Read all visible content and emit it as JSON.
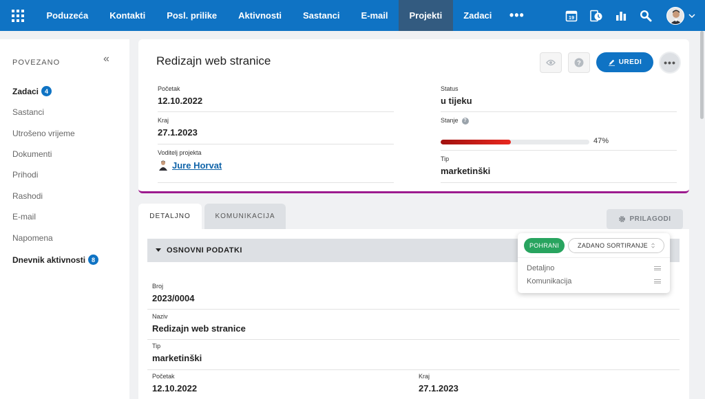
{
  "nav": {
    "items": [
      {
        "label": "Poduzeća",
        "active": false
      },
      {
        "label": "Kontakti",
        "active": false
      },
      {
        "label": "Posl. prilike",
        "active": false
      },
      {
        "label": "Aktivnosti",
        "active": false
      },
      {
        "label": "Sastanci",
        "active": false
      },
      {
        "label": "E-mail",
        "active": false
      },
      {
        "label": "Projekti",
        "active": true
      },
      {
        "label": "Zadaci",
        "active": false
      }
    ],
    "more": "•••",
    "calendar_day": "19",
    "brand_color": "#0f73c4"
  },
  "sidebar": {
    "heading": "POVEZANO",
    "collapse": "«",
    "items": [
      {
        "label": "Zadaci",
        "badge": "4",
        "bold": true
      },
      {
        "label": "Sastanci"
      },
      {
        "label": "Utrošeno vrijeme"
      },
      {
        "label": "Dokumenti"
      },
      {
        "label": "Prihodi"
      },
      {
        "label": "Rashodi"
      },
      {
        "label": "E-mail"
      },
      {
        "label": "Napomena"
      },
      {
        "label": "Dnevnik aktivnosti",
        "badge": "8",
        "bold": true
      }
    ]
  },
  "header": {
    "title": "Redizajn web stranice",
    "edit_label": "UREDI",
    "fields": {
      "start_label": "Početak",
      "start_value": "12.10.2022",
      "end_label": "Kraj",
      "end_value": "27.1.2023",
      "lead_label": "Voditelj projekta",
      "lead_value": "Jure Horvat",
      "status_label": "Status",
      "status_value": "u tijeku",
      "stanje_label": "Stanje",
      "stanje_percent": 47,
      "stanje_text": "47%",
      "tip_label": "Tip",
      "tip_value": "marketinški"
    }
  },
  "tabs": [
    {
      "label": "DETALJNO",
      "active": true
    },
    {
      "label": "KOMUNIKACIJA",
      "active": false
    }
  ],
  "customize_label": "PRILAGODI",
  "section": {
    "title": "OSNOVNI PODATKI",
    "fields": {
      "broj_label": "Broj",
      "broj_value": "2023/0004",
      "naziv_label": "Naziv",
      "naziv_value": "Redizajn web stranice",
      "tip_label": "Tip",
      "tip_value": "marketinški",
      "start_label": "Početak",
      "start_value": "12.10.2022",
      "end_label": "Kraj",
      "end_value": "27.1.2023"
    }
  },
  "popover": {
    "save_label": "POHRANI",
    "sort_label": "ZADANO SORTIRANJE",
    "rows": [
      "Detaljno",
      "Komunikacija"
    ]
  }
}
